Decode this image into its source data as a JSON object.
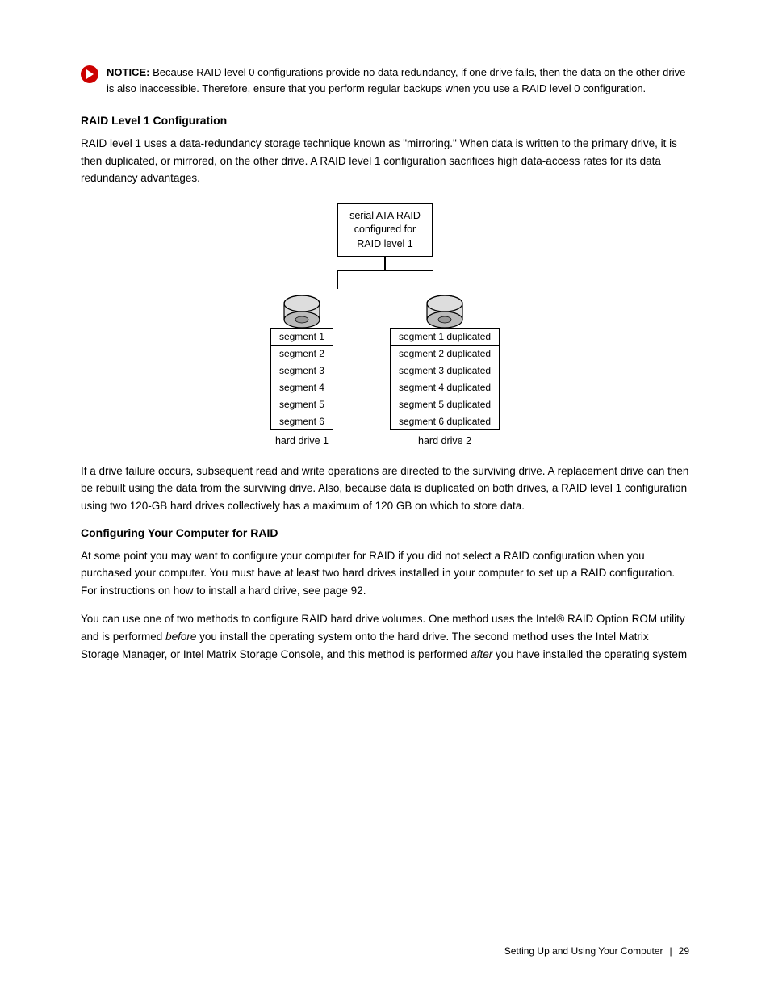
{
  "notice": {
    "label": "NOTICE:",
    "text": "Because RAID level 0 configurations provide no data redundancy, if one drive fails, then the data on the other drive is also inaccessible. Therefore, ensure that you perform regular backups when you use a RAID level 0 configuration."
  },
  "section1": {
    "heading": "RAID Level 1 Configuration",
    "paragraphs": [
      "RAID level 1 uses a data-redundancy storage technique known as \"mirroring.\" When data is written to the primary drive, it is then duplicated, or mirrored, on the other drive. A RAID level 1 configuration sacrifices high data-access rates for its data redundancy advantages."
    ]
  },
  "diagram": {
    "raid_label": "serial ATA RAID\nconfigured for\nRAID level 1",
    "drive1_label": "hard drive 1",
    "drive2_label": "hard drive 2",
    "segments_left": [
      "segment 1",
      "segment 2",
      "segment 3",
      "segment 4",
      "segment 5",
      "segment 6"
    ],
    "segments_right": [
      "segment 1 duplicated",
      "segment 2 duplicated",
      "segment 3 duplicated",
      "segment 4 duplicated",
      "segment 5 duplicated",
      "segment 6 duplicated"
    ]
  },
  "section1_after": {
    "paragraph": "If a drive failure occurs, subsequent read and write operations are directed to the surviving drive. A replacement drive can then be rebuilt using the data from the surviving drive. Also, because data is duplicated on both drives, a RAID level 1 configuration using two 120-GB hard drives collectively has a maximum of 120 GB on which to store data."
  },
  "section2": {
    "heading": "Configuring Your Computer for RAID",
    "paragraphs": [
      "At some point you may want to configure your computer for RAID if you did not select a RAID configuration when you purchased your computer. You must have at least two hard drives installed in your computer to set up a RAID configuration. For instructions on how to install a hard drive, see page 92.",
      "You can use one of two methods to configure RAID hard drive volumes. One method uses the Intel® RAID Option ROM utility and is performed before you install the operating system onto the hard drive. The second method uses the Intel Matrix Storage Manager, or Intel Matrix Storage Console, and this method is performed after you have installed the operating system"
    ]
  },
  "footer": {
    "left": "Setting Up and Using Your Computer",
    "separator": "|",
    "page": "29"
  }
}
